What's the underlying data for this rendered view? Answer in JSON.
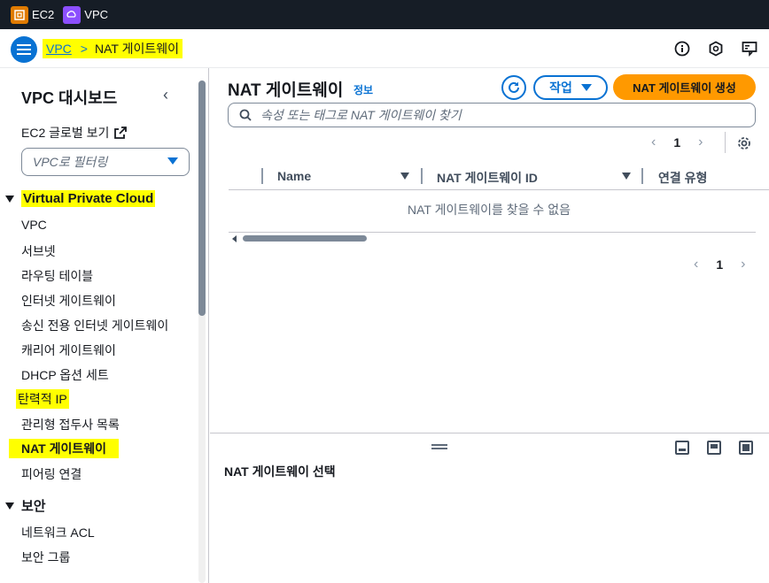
{
  "topbar": {
    "services": [
      {
        "label": "EC2",
        "color": "#e07b00"
      },
      {
        "label": "VPC",
        "color": "#8c4fff"
      }
    ]
  },
  "header": {
    "breadcrumb_root": "VPC",
    "breadcrumb_current": "NAT 게이트웨이",
    "highlight_color": "#ffff00"
  },
  "sidebar": {
    "title": "VPC 대시보드",
    "ec2_global": "EC2 글로벌 보기",
    "filter_placeholder": "VPC로 필터링",
    "section_vpc": "Virtual Private Cloud",
    "vpc_items": [
      "VPC",
      "서브넷",
      "라우팅 테이블",
      "인터넷 게이트웨이",
      "송신 전용 인터넷 게이트웨이",
      "캐리어 게이트웨이",
      "DHCP 옵션 세트",
      "탄력적 IP",
      "관리형 접두사 목록",
      "NAT 게이트웨이",
      "피어링 연결"
    ],
    "section_security": "보안",
    "security_items": [
      "네트워크 ACL",
      "보안 그룹"
    ]
  },
  "main": {
    "title": "NAT 게이트웨이",
    "info": "정보",
    "actions_label": "작업",
    "create_label": "NAT 게이트웨이 생성",
    "search_placeholder": "속성 또는 태그로 NAT 게이트웨이 찾기",
    "page_number": "1",
    "columns": [
      "Name",
      "NAT 게이트웨이 ID",
      "연결 유형"
    ],
    "empty_message": "NAT 게이트웨이를 찾을 수 없음",
    "accent_color": "#0972d3",
    "primary_color": "#ff9900"
  },
  "split_panel": {
    "title": "NAT 게이트웨이 선택"
  }
}
